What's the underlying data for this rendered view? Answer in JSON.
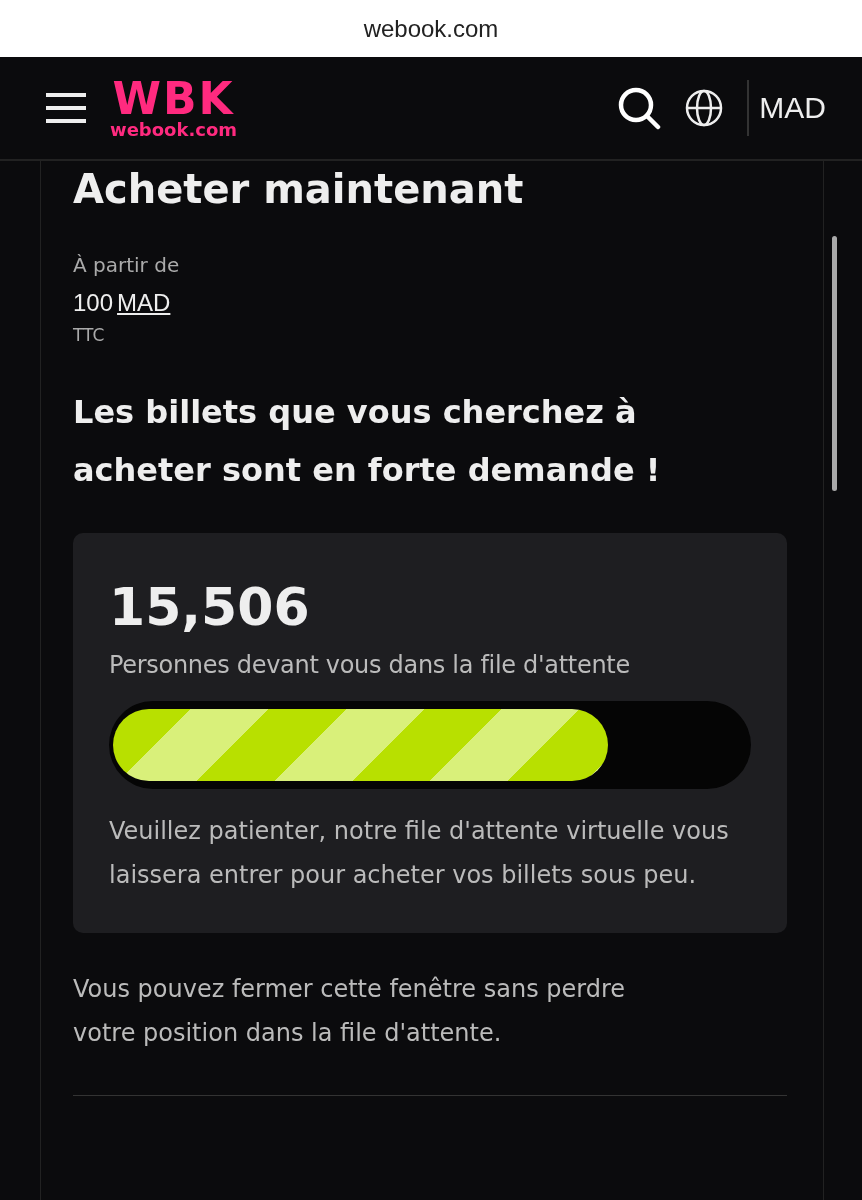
{
  "address_bar": {
    "url": "webook.com"
  },
  "header": {
    "logo": {
      "mark": "WBK",
      "domain": "webook.com"
    },
    "currency": "MAD"
  },
  "purchase": {
    "title": "Acheter maintenant",
    "price_label": "À partir de",
    "price_amount": "100",
    "price_currency": "MAD",
    "tax_note": "TTC",
    "headline": "Les billets que vous cherchez à acheter sont en forte demande !",
    "queue": {
      "count": "15,506",
      "count_label": "Personnes devant vous dans la file d'attente",
      "level": 0.78,
      "message": "Veuillez patienter, notre file d'attente virtuelle vous laissera entrer pour acheter vos billets sous peu."
    },
    "footnote": "Vous pouvez fermer cette fenêtre sans perdre votre position dans la file d'attente."
  }
}
